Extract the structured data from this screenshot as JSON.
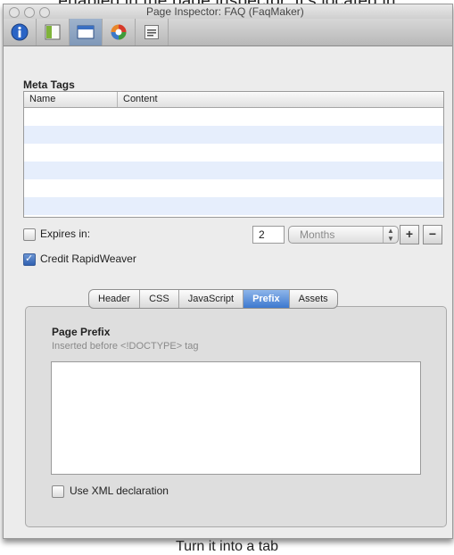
{
  "caption": {
    "top": "enabled in the page inspector. It's located in",
    "bottom": "Turn it into a tab"
  },
  "window": {
    "title": "Page Inspector: FAQ (FaqMaker)"
  },
  "toolbar": {
    "buttons": [
      {
        "name": "info-icon",
        "selected": false
      },
      {
        "name": "page-layout-icon",
        "selected": false
      },
      {
        "name": "window-icon",
        "selected": true
      },
      {
        "name": "color-wheel-icon",
        "selected": false
      },
      {
        "name": "html-code-icon",
        "selected": false
      }
    ]
  },
  "meta_tags": {
    "title": "Meta Tags",
    "columns": [
      "Name",
      "Content"
    ],
    "rows": [
      [
        "",
        ""
      ],
      [
        "",
        ""
      ],
      [
        "",
        ""
      ],
      [
        "",
        ""
      ],
      [
        "",
        ""
      ],
      [
        "",
        ""
      ]
    ]
  },
  "expires": {
    "label": "Expires in:",
    "checked": false,
    "value": "2",
    "unit": "Months"
  },
  "credit": {
    "label": "Credit RapidWeaver",
    "checked": true
  },
  "buttons": {
    "add": "+",
    "remove": "−"
  },
  "tabs": {
    "items": [
      "Header",
      "CSS",
      "JavaScript",
      "Prefix",
      "Assets"
    ],
    "active": "Prefix"
  },
  "prefix": {
    "title": "Page Prefix",
    "subtitle": "Inserted before <!DOCTYPE> tag",
    "content": "",
    "xml_label": "Use XML declaration",
    "xml_checked": false
  },
  "colors": {
    "accent": "#3d78cf",
    "selected_toolbar": "#8ea6c4"
  }
}
